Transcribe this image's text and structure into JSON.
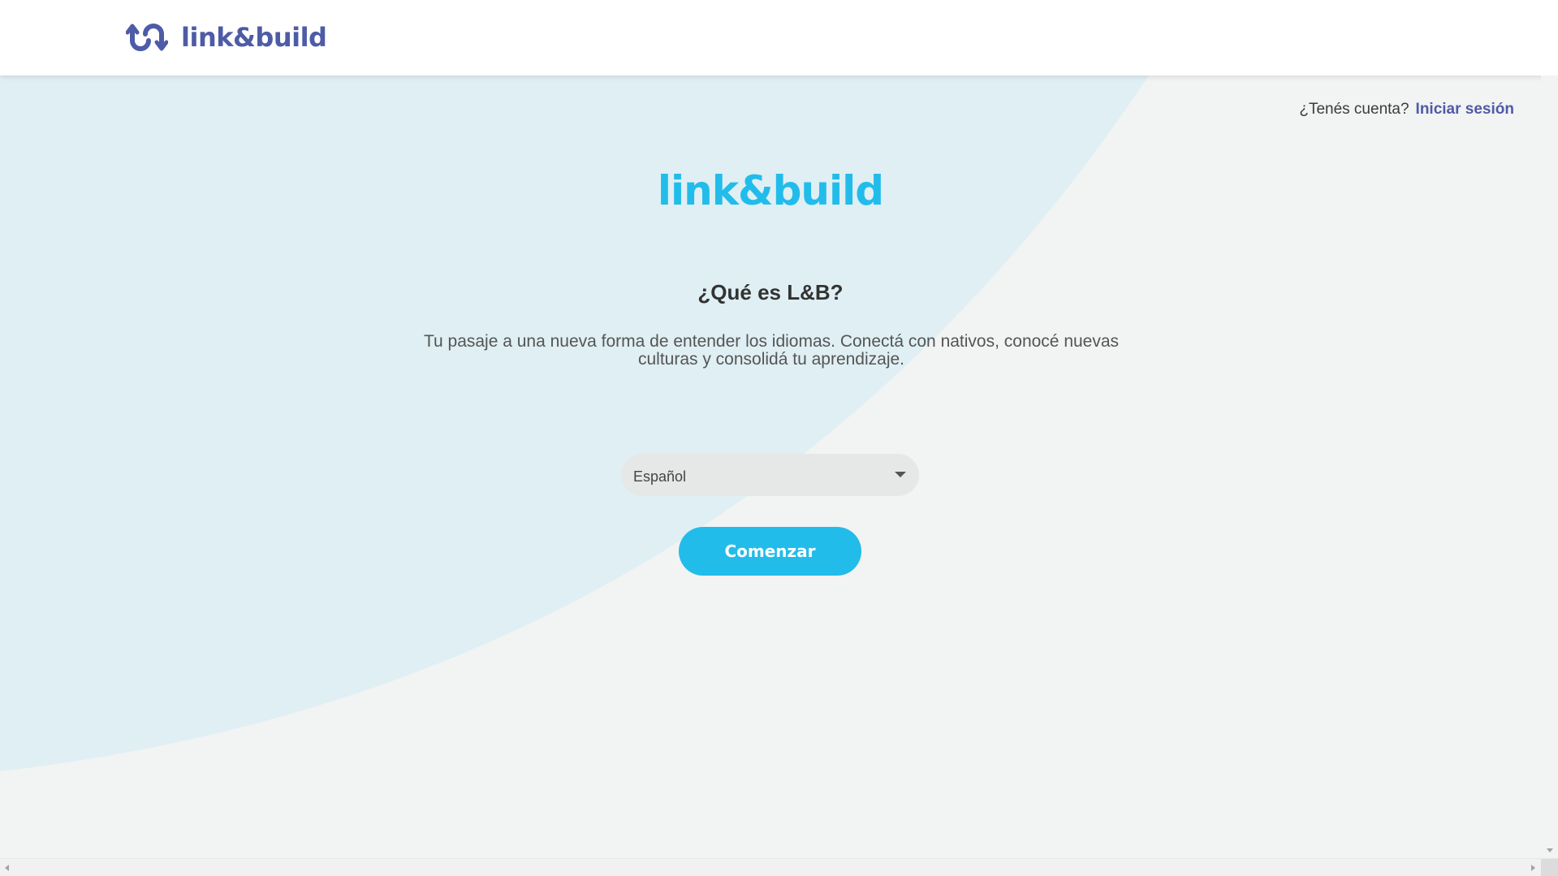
{
  "header": {
    "logo_text": "link&build",
    "logo_icon": "link-build-arrows-icon",
    "brand_color": "#4e5ba6"
  },
  "login_prompt": {
    "question": "¿Tenés cuenta?",
    "link_label": "Iniciar sesión"
  },
  "main": {
    "brand_logo": "link&build",
    "brand_color": "#22bcea",
    "heading": "¿Qué es L&B?",
    "description": "Tu pasaje a una nueva forma de entender los idiomas. Conectá con nativos, conocé nuevas culturas y consolidá tu aprendizaje.",
    "language_select": {
      "value": "Español",
      "icon": "caret-down-icon"
    },
    "start_button_label": "Comenzar"
  },
  "colors": {
    "background": "#f2f3f3",
    "curve": "#dfeff3",
    "accent": "#22bcea"
  }
}
